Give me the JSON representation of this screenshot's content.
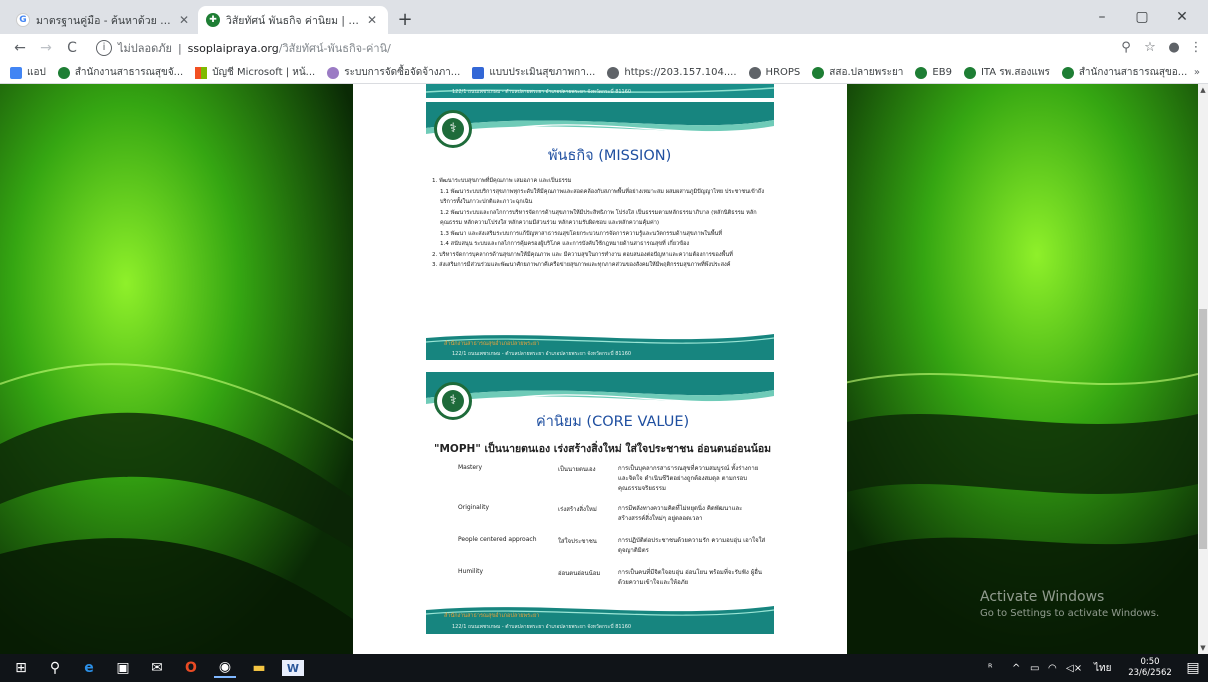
{
  "browser": {
    "tabs": [
      {
        "title": "มาตรฐานคู่มือ - ค้นหาด้วย Google",
        "favicon": "google-icon",
        "active": false
      },
      {
        "title": "วิสัยทัศน์ พันธกิจ ค่านิยม | สำนักงานส",
        "favicon": "moph-site-icon",
        "active": true
      }
    ],
    "new_tab": "+",
    "window_controls": {
      "minimize": "–",
      "maximize": "▢",
      "close": "✕"
    },
    "nav": {
      "back": "←",
      "forward": "→",
      "reload": "C"
    },
    "address": {
      "security_label": "ไม่ปลอดภัย",
      "separator": "|",
      "host": "ssoplaipraya.org",
      "path": "/วิสัยทัศน์-พันธกิจ-ค่านิ/"
    },
    "toolbar_icons": [
      "zoom-icon",
      "star-icon",
      "profile-icon",
      "menu-icon"
    ],
    "bookmarks": [
      {
        "label": "แอป",
        "icon": "apps-icon",
        "color": "#4285f4"
      },
      {
        "label": "สำนักงานสาธารณสุขจั...",
        "icon": "moph-icon",
        "color": "#1e7e34"
      },
      {
        "label": "บัญชี Microsoft | หน้...",
        "icon": "microsoft-icon",
        "color": "#f25022"
      },
      {
        "label": "ระบบการจัดซื้อจัดจ้างภา...",
        "icon": "procurement-icon",
        "color": "#9b7bc4"
      },
      {
        "label": "แบบประเมินสุขภาพกา...",
        "icon": "form-icon",
        "color": "#3367d6"
      },
      {
        "label": "https://203.157.104....",
        "icon": "globe-icon",
        "color": "#5f6368"
      },
      {
        "label": "HROPS",
        "icon": "globe-icon",
        "color": "#5f6368"
      },
      {
        "label": "สสอ.ปลายพระยา",
        "icon": "moph-icon",
        "color": "#1e7e34"
      },
      {
        "label": "EB9",
        "icon": "moph-icon",
        "color": "#1e7e34"
      },
      {
        "label": "ITA รพ.สองแพร",
        "icon": "moph-icon",
        "color": "#1e7e34"
      },
      {
        "label": "สำนักงานสาธารณสุขอ...",
        "icon": "moph-icon",
        "color": "#1e7e34"
      }
    ],
    "bookmarks_more": "»"
  },
  "mission_slide": {
    "header_strip": "122/1 ถนนเพชรเกษม - ตำบลปลายพระยา อำเภอปลายพระยา จังหวัดกระบี่ 81160",
    "title": "พันธกิจ (MISSION)",
    "items": [
      "1. พัฒนาระบบสุขภาพที่มีคุณภาพ เสมอภาค และเป็นธรรม",
      "1.1 พัฒนาระบบบริการสุขภาพทุกระดับให้มีคุณภาพและสอดคล้องกับสภาพพื้นที่อย่างเหมาะสม ผสมผสานภูมิปัญญาไทย ประชาชนเข้าถึงบริการทั้งในภาวะปกติและภาวะฉุกเฉิน",
      "1.2 พัฒนาระบบและกลไกการบริหารจัดการด้านสุขภาพให้มีประสิทธิภาพ โปร่งใส เป็นธรรมตามหลักธรรมาภิบาล (หลักนิติธรรม หลักคุณธรรม หลักความโปร่งใส หลักความมีส่วนร่วม หลักความรับผิดชอบ และหลักความคุ้มค่า)",
      "1.3 พัฒนา และส่งเสริมระบบการแก้ปัญหาสาธารณสุขโดยกระบวนการจัดการความรู้และนวัตกรรมด้านสุขภาพในพื้นที่",
      "1.4 สนับสนุน ระบบและกลไกการคุ้มครองผู้บริโภค และการบังคับใช้กฎหมายด้านสาธารณสุขที่ เกี่ยวข้อง",
      "2. บริหารจัดการบุคลากรด้านสุขภาพให้มีคุณภาพ และ มีความสุขในการทำงาน ตอบสนองต่อปัญหาและความต้องการของพื้นที่",
      "3. ส่งเสริมการมีส่วนร่วมและพัฒนาศักยภาพภาคีเครือข่ายสุขภาพและทุกภาคส่วนของสังคมให้มีพฤติกรรมสุขภาพที่พึงประสงค์"
    ],
    "footer_accent": "สำนักงานสาธารณสุขอำเภอปลายพระยา",
    "footer": "122/1 ถนนเพชรเกษม - ตำบลปลายพระยา อำเภอปลายพระยา จังหวัดกระบี่ 81160"
  },
  "core_value_slide": {
    "title": "ค่านิยม (CORE VALUE)",
    "moph_line": "\"MOPH\"   เป็นนายตนเอง  เร่งสร้างสิ่งใหม่  ใส่ใจประชาชน  อ่อนตนอ่อนน้อม",
    "rows": [
      {
        "en": "Mastery",
        "th": "เป็นนายตนเอง",
        "desc": "การเป็นบุคลากรสาธารณสุขที่ความสมบูรณ์ ทั้งร่างกายและจิตใจ ดำเนินชีวิตอย่างถูกต้องสมดุล ตามกรอบคุณธรรมจริยธรรม"
      },
      {
        "en": "Originality",
        "th": "เร่งสร้างสิ่งใหม่",
        "desc": "การมีพลังทางความคิดที่ไม่หยุดนิ่ง คิดพัฒนาและ สร้างสรรค์สิ่งใหม่ๆ อยู่ตลอดเวลา"
      },
      {
        "en": "People centered approach",
        "th": "ใส่ใจประชาชน",
        "desc": "การปฏิบัติต่อประชาชนด้วยความรัก ความอบอุ่น เอาใจใส่ดุจญาติมิตร"
      },
      {
        "en": "Humility",
        "th": "อ่อนตนอ่อนน้อม",
        "desc": "การเป็นคนที่มีจิตใจอบอุ่น อ่อนโยน พร้อมที่จะรับฟัง ผู้อื่นด้วยความเข้าใจและให้อภัย"
      }
    ],
    "footer_accent": "สำนักงานสาธารณสุขอำเภอปลายพระยา",
    "footer": "122/1 ถนนเพชรเกษม - ตำบลปลายพระยา อำเภอปลายพระยา จังหวัดกระบี่ 81160"
  },
  "watermark": {
    "line1": "Activate Windows",
    "line2": "Go to Settings to activate Windows."
  },
  "taskbar": {
    "apps": [
      "windows-start-icon",
      "search-icon",
      "edge-icon",
      "store-icon",
      "mail-icon",
      "office-icon",
      "chrome-icon",
      "file-explorer-icon",
      "word-icon"
    ],
    "tray_language": "ไทย",
    "clock_time": "0:50",
    "clock_date": "23/6/2562"
  },
  "colors": {
    "accent_teal": "#1b8f8a",
    "title_blue": "#1f4fa0",
    "bg_green": "#3fae12"
  }
}
